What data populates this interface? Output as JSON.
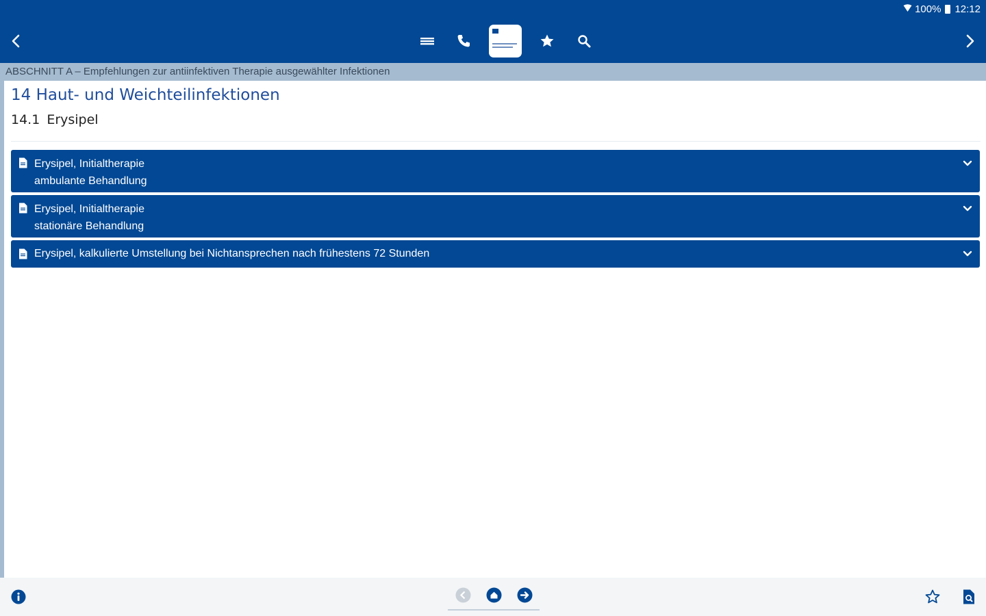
{
  "status_bar": {
    "battery": "100%",
    "time": "12:12"
  },
  "toolbar": {
    "icons": [
      "back-icon",
      "list-icon",
      "phone-icon",
      "app-logo",
      "star-icon",
      "search-icon",
      "forward-icon"
    ]
  },
  "section": {
    "label": "ABSCHNITT A – Empfehlungen zur antiinfektiven Therapie ausgewählter Infektionen"
  },
  "chapter": {
    "title": "14 Haut- und Weichteilinfektionen"
  },
  "subsection": {
    "number": "14.1",
    "title": "Erysipel"
  },
  "accordion": {
    "items": [
      {
        "line1": "Erysipel, Initialtherapie",
        "line2": "ambulante Behandlung"
      },
      {
        "line1": "Erysipel, Initialtherapie",
        "line2": "stationäre Behandlung"
      },
      {
        "line1": "Erysipel, kalkulierte Umstellung bei Nichtansprechen nach frühestens 72 Stunden"
      }
    ]
  },
  "bottombar": {
    "icons": [
      "info-icon",
      "pager-prev-icon",
      "pager-home-icon",
      "pager-next-icon",
      "favorite-icon",
      "document-icon"
    ]
  },
  "colors": {
    "primary": "#024894",
    "section_band": "#a5bbd0",
    "heading": "#1f4d9b",
    "bottom_bg": "#f3f5f7"
  }
}
